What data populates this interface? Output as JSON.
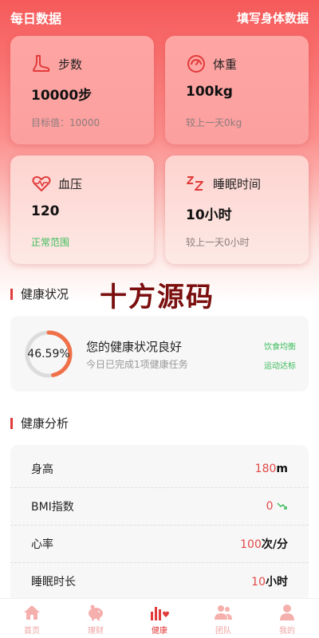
{
  "header": {
    "title": "每日数据",
    "action": "填写身体数据"
  },
  "cards": [
    {
      "icon": "foot-icon",
      "label": "步数",
      "value": "10000步",
      "sub": "目标值：10000"
    },
    {
      "icon": "gauge-icon",
      "label": "体重",
      "value": "100kg",
      "sub": "较上一天0kg"
    },
    {
      "icon": "heart-pulse-icon",
      "label": "血压",
      "value": "120",
      "sub": "正常范围"
    },
    {
      "icon": "sleep-icon",
      "label": "睡眠时间",
      "value": "10小时",
      "sub": "较上一天0小时"
    }
  ],
  "health_status": {
    "title": "健康状况",
    "watermark": "十方源码",
    "percent_text": "46.59%",
    "percent": 0.4659,
    "main": "您的健康状况良好",
    "sub": "今日已完成1项健康任务",
    "tags": [
      "饮食均衡",
      "运动达标"
    ]
  },
  "analysis": {
    "title": "健康分析",
    "rows": [
      {
        "key": "身高",
        "num": "180",
        "unit": "m"
      },
      {
        "key": "BMI指数",
        "num": "0",
        "unit": ""
      },
      {
        "key": "心率",
        "num": "100",
        "unit": "次/分"
      },
      {
        "key": "睡眠时长",
        "num": "10",
        "unit": "小时"
      }
    ]
  },
  "tabs": [
    {
      "label": "首页",
      "icon": "home-icon"
    },
    {
      "label": "理财",
      "icon": "piggy-bank-icon"
    },
    {
      "label": "健康",
      "icon": "health-chart-icon"
    },
    {
      "label": "团队",
      "icon": "team-icon"
    },
    {
      "label": "我的",
      "icon": "user-icon"
    }
  ],
  "colors": {
    "accent": "#e23b3b",
    "ok": "#3dbd5c",
    "ring": "#f07048"
  }
}
